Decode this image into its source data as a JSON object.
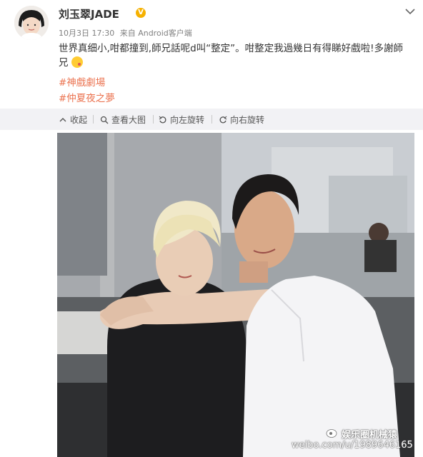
{
  "post": {
    "username": "刘玉翠JADE",
    "verified_badge": "V",
    "date": "10月3日 17:30",
    "source": "来自 Android客户端",
    "text_line1": "世界真细小,咁都撞到,師兄話呢d叫“整定”。咁整定我過幾日有得睇好戲啦!多謝師",
    "text_line2": "兄",
    "topic1": "#神戲劇場",
    "topic2": "#仲夏夜之夢"
  },
  "toolbar": {
    "collapse_label": "收起",
    "view_large_label": "查看大图",
    "rotate_left_label": "向左旋转",
    "rotate_right_label": "向右旋转"
  },
  "photo": {
    "watermark_name": "娱乐圈机械猿",
    "watermark_url": "weibo.com/u/1989646165"
  },
  "colors": {
    "accent": "#eb7350",
    "toolbar_bg": "#f2f2f5",
    "verified": "#f6b100"
  }
}
